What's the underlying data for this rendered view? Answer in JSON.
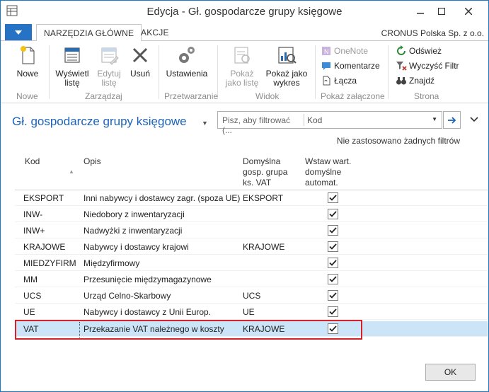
{
  "window": {
    "title": "Edycja - Gł. gospodarcze grupy księgowe"
  },
  "ribbon_tabs": {
    "home": "NARZĘDZIA GŁÓWNE",
    "actions": "AKCJE",
    "company": "CRONUS Polska Sp. z o.o."
  },
  "ribbon": {
    "new": "Nowe",
    "show_list": "Wyświetl listę",
    "edit_list": "Edytuj listę",
    "delete": "Usuń",
    "settings": "Ustawienia",
    "show_as_list": "Pokaż jako listę",
    "show_as_chart": "Pokaż jako wykres",
    "onenote": "OneNote",
    "comments": "Komentarze",
    "links": "Łącza",
    "refresh": "Odśwież",
    "clear_filter": "Wyczyść Filtr",
    "find": "Znajdź",
    "groups": {
      "new": "Nowe",
      "manage": "Zarządzaj",
      "process": "Przetwarzanie",
      "view": "Widok",
      "attachments": "Pokaż załączone",
      "page": "Strona"
    }
  },
  "page": {
    "title": "Gł. gospodarcze grupy księgowe",
    "filter_placeholder": "Pisz, aby filtrować (...",
    "filter_field": "Kod",
    "no_filters": "Nie zastosowano żadnych filtrów"
  },
  "grid": {
    "headers": {
      "code": "Kod",
      "desc": "Opis",
      "group_l1": "Domyślna",
      "group_l2": "gosp. grupa",
      "group_l3": "ks. VAT",
      "insert_l1": "Wstaw wart.",
      "insert_l2": "domyślne",
      "insert_l3": "automat."
    },
    "rows": [
      {
        "code": "EKSPORT",
        "desc": "Inni nabywcy i dostawcy zagr. (spoza UE)",
        "group": "EKSPORT",
        "auto": true
      },
      {
        "code": "INW-",
        "desc": "Niedobory z inwentaryzacji",
        "group": "",
        "auto": true
      },
      {
        "code": "INW+",
        "desc": "Nadwyżki z inwentaryzacji",
        "group": "",
        "auto": true
      },
      {
        "code": "KRAJOWE",
        "desc": "Nabywcy i dostawcy krajowi",
        "group": "KRAJOWE",
        "auto": true
      },
      {
        "code": "MIEDZYFIRM",
        "desc": "Międzyfirmowy",
        "group": "",
        "auto": true
      },
      {
        "code": "MM",
        "desc": "Przesunięcie międzymagazynowe",
        "group": "",
        "auto": true
      },
      {
        "code": "UCS",
        "desc": "Urząd Celno-Skarbowy",
        "group": "UCS",
        "auto": true
      },
      {
        "code": "UE",
        "desc": "Nabywcy i dostawcy z Unii Europ.",
        "group": "UE",
        "auto": true
      },
      {
        "code": "VAT",
        "desc": "Przekazanie VAT należnego w koszty",
        "group": "KRAJOWE",
        "auto": true
      }
    ]
  },
  "footer": {
    "ok": "OK"
  },
  "colors": {
    "accent": "#2672c4",
    "title_blue": "#1c62b9",
    "selection": "#cce4f7",
    "highlight_border": "#d3232a"
  }
}
